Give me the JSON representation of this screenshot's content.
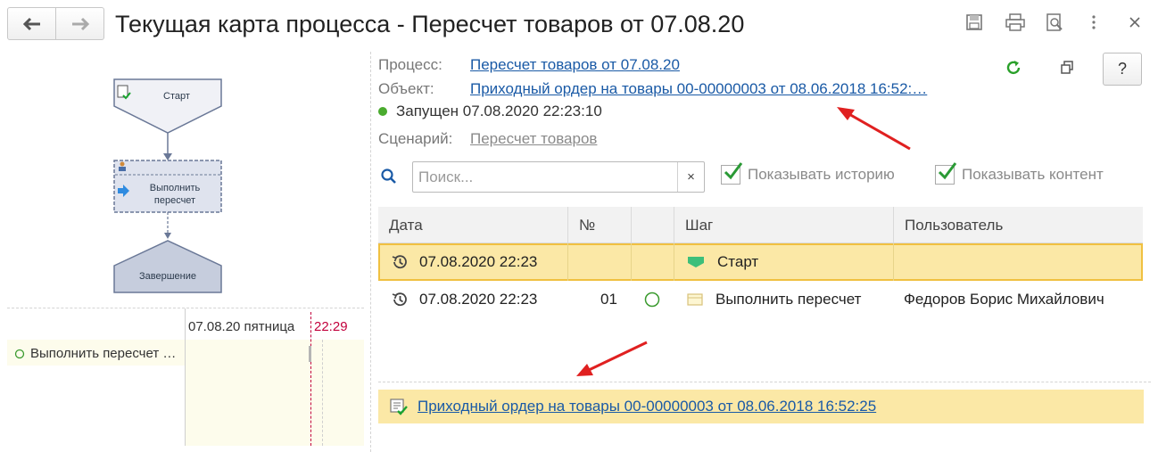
{
  "window": {
    "title": "Текущая карта процесса - Пересчет товаров от 07.08.20",
    "toolbar_icons": [
      "back-arrow-icon",
      "forward-arrow-icon",
      "save-icon",
      "print-icon",
      "print-preview-icon",
      "more-icon",
      "close-icon"
    ]
  },
  "process_map": {
    "nodes": [
      {
        "label": "Старт",
        "icon": "start-task-icon"
      },
      {
        "label": "Выполнить пересчет",
        "icon": "user-icon"
      },
      {
        "label": "Завершение",
        "icon": "end-icon"
      }
    ]
  },
  "timeline": {
    "date_header": "07.08.20 пятница",
    "time_marker": "22:29",
    "row_label": "Выполнить пересчет …"
  },
  "details": {
    "process_label": "Процесс:",
    "process_value": "Пересчет товаров от 07.08.20",
    "object_label": "Объект:",
    "object_value": "Приходный ордер на товары 00-00000003 от 08.06.2018 16:52:…",
    "status": "Запущен 07.08.2020 22:23:10",
    "status_color": "#4aab2e",
    "scenario_label": "Сценарий:",
    "scenario_value": "Пересчет товаров",
    "help_label": "?"
  },
  "filters": {
    "search_placeholder": "Поиск...",
    "search_value": "",
    "clear_label": "×",
    "show_history_label": "Показывать историю",
    "show_history_checked": true,
    "show_content_label": "Показывать контент",
    "show_content_checked": true
  },
  "table": {
    "columns": [
      "Дата",
      "№",
      "",
      "Шаг",
      "Пользователь"
    ],
    "rows": [
      {
        "date": "07.08.2020 22:23",
        "num": "",
        "state": "",
        "step": "Старт",
        "user": "",
        "selected": true
      },
      {
        "date": "07.08.2020 22:23",
        "num": "01",
        "state": "circle",
        "step": "Выполнить пересчет",
        "user": "Федоров Борис Михайлович",
        "selected": false
      }
    ]
  },
  "document": {
    "link": "Приходный ордер на товары 00-00000003 от 08.06.2018 16:52:25"
  },
  "colors": {
    "accent_link": "#1a5aa6",
    "selection": "#fbe8a6",
    "annotation_arrow": "#e02020"
  }
}
